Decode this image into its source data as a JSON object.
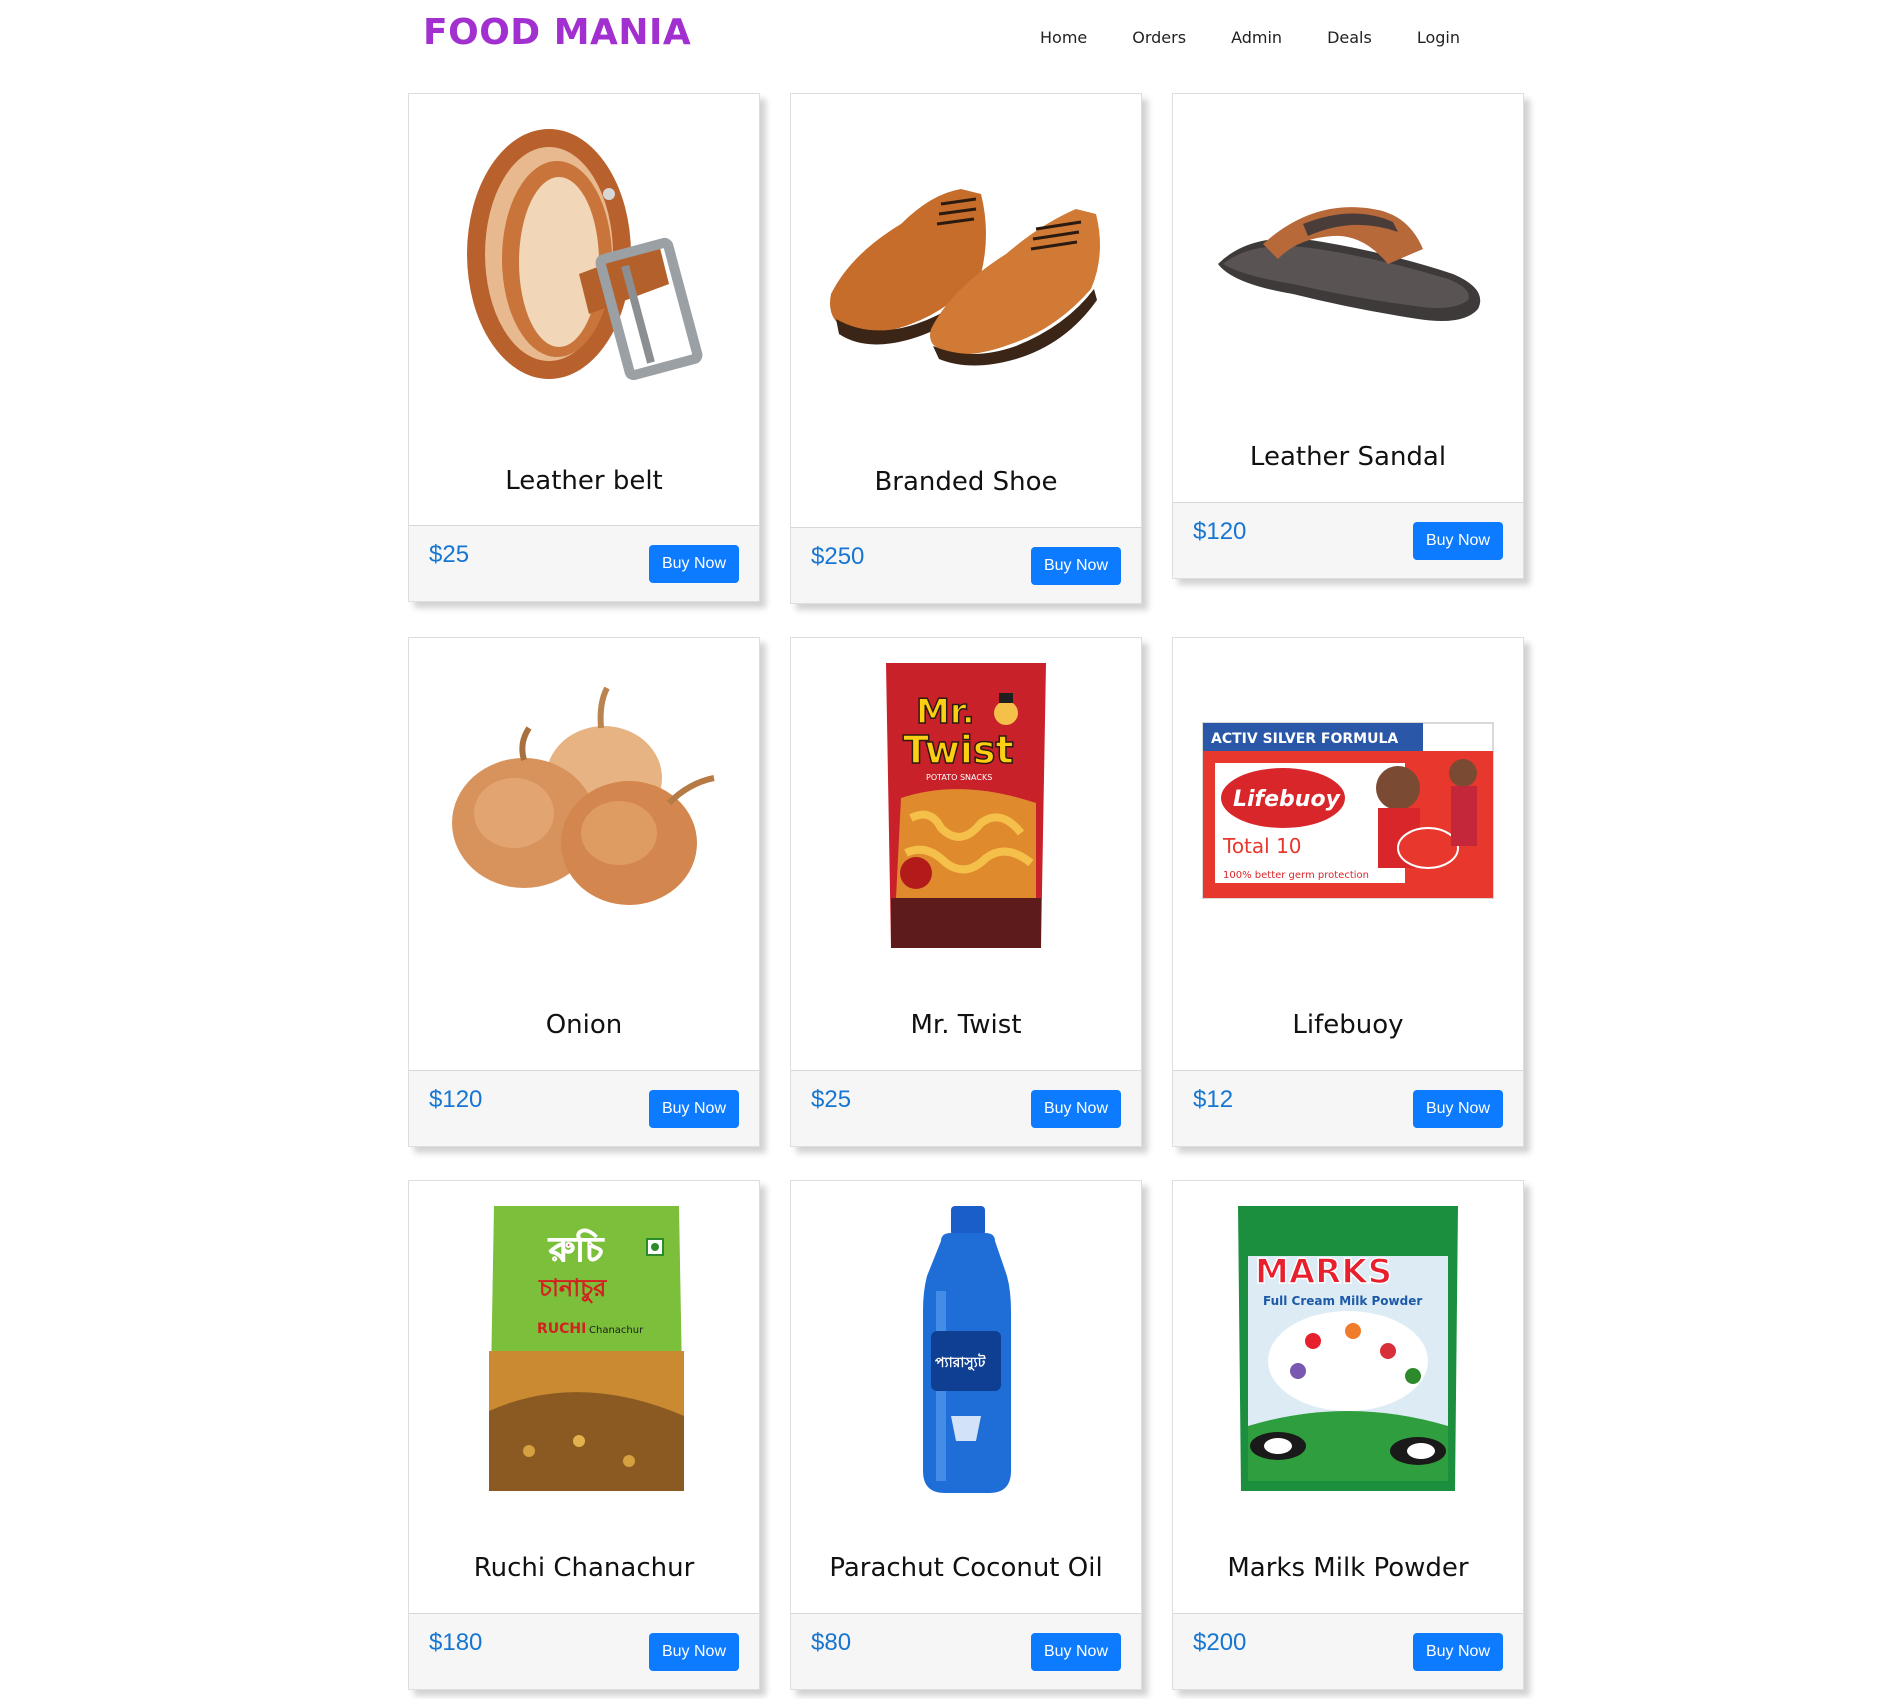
{
  "brand": "FOOD MANIA",
  "nav": [
    "Home",
    "Orders",
    "Admin",
    "Deals",
    "Login"
  ],
  "colors": {
    "brand": "#a22fcf",
    "price": "#1676d2",
    "button": "#0d7bff"
  },
  "products": [
    {
      "name": "Leather belt",
      "price": "$25",
      "button": "Buy Now",
      "image": "leather-belt-image"
    },
    {
      "name": "Branded Shoe",
      "price": "$250",
      "button": "Buy Now",
      "image": "branded-shoe-image"
    },
    {
      "name": "Leather Sandal",
      "price": "$120",
      "button": "Buy Now",
      "image": "leather-sandal-image"
    },
    {
      "name": "Onion",
      "price": "$120",
      "button": "Buy Now",
      "image": "onion-image"
    },
    {
      "name": "Mr. Twist",
      "price": "$25",
      "button": "Buy Now",
      "image": "mr-twist-image",
      "package_text": [
        "Mr.",
        "Twist",
        "POTATO SNACKS"
      ]
    },
    {
      "name": "Lifebuoy",
      "price": "$12",
      "button": "Buy Now",
      "image": "lifebuoy-image",
      "package_text": [
        "ACTIV SILVER FORMULA",
        "Lifebuoy",
        "Total 10",
        "100% better germ protection"
      ]
    },
    {
      "name": "Ruchi Chanachur",
      "price": "$180",
      "button": "Buy Now",
      "image": "ruchi-chanachur-image",
      "package_text": [
        "রুচি",
        "চানাচুর",
        "RUCHI",
        "Chanachur"
      ]
    },
    {
      "name": "Parachut Coconut Oil",
      "price": "$80",
      "button": "Buy Now",
      "image": "parachute-oil-image",
      "package_text": [
        "প্যারাস্যুট"
      ]
    },
    {
      "name": "Marks Milk Powder",
      "price": "$200",
      "button": "Buy Now",
      "image": "marks-milk-image",
      "package_text": [
        "MARKS",
        "Full Cream Milk Powder"
      ]
    }
  ]
}
